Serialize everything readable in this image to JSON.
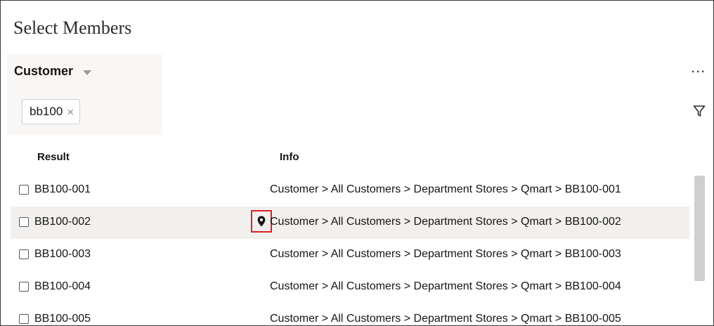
{
  "dialog": {
    "title": "Select Members"
  },
  "dimension": {
    "label": "Customer",
    "caret_icon": "caret-down-icon"
  },
  "search_chip": {
    "label": "bb100",
    "remove_symbol": "×"
  },
  "toolbar": {
    "more_symbol": "...",
    "filter_icon": "filter-icon"
  },
  "table": {
    "headers": {
      "result": "Result",
      "info": "Info"
    },
    "rows": [
      {
        "result": "BB100-001",
        "info": "Customer > All Customers > Department Stores > Qmart > BB100-001"
      },
      {
        "result": "BB100-002",
        "info": "Customer > All Customers > Department Stores > Qmart > BB100-002"
      },
      {
        "result": "BB100-003",
        "info": "Customer > All Customers > Department Stores > Qmart > BB100-003"
      },
      {
        "result": "BB100-004",
        "info": "Customer > All Customers > Department Stores > Qmart > BB100-004"
      },
      {
        "result": "BB100-005",
        "info": "Customer > All Customers > Department Stores > Qmart > BB100-005"
      }
    ],
    "highlighted_row": 1,
    "highlight_marker_icon": "map-pin-icon"
  },
  "colors": {
    "highlight_border": "#e02020",
    "row_hover": "#f1f0ef"
  }
}
